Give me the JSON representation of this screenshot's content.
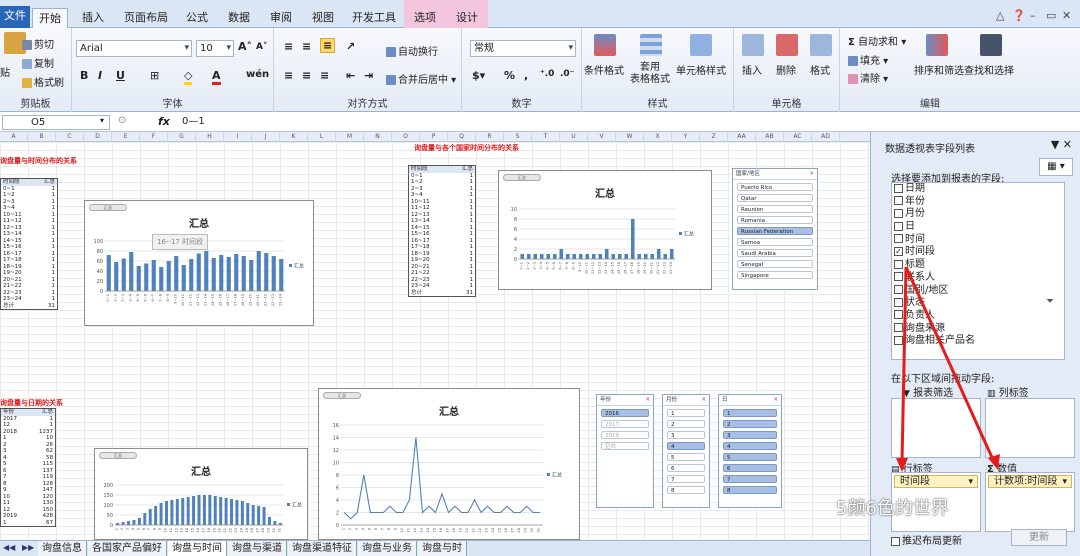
{
  "ribbon_tabs": [
    "文件",
    "开始",
    "插入",
    "页面布局",
    "公式",
    "数据",
    "审阅",
    "视图",
    "开发工具",
    "选项",
    "设计"
  ],
  "active_tab": "开始",
  "clipboard": {
    "paste": "贴",
    "cut": "剪切",
    "copy": "复制",
    "format_painter": "格式刷",
    "label": "剪贴板"
  },
  "font": {
    "name": "Arial",
    "size": "10",
    "bold": "B",
    "italic": "I",
    "underline": "U",
    "wen": "wén",
    "label": "字体"
  },
  "alignment": {
    "wrap": "自动换行",
    "merge": "合并后居中",
    "label": "对齐方式"
  },
  "number": {
    "format": "常规",
    "percent": "%",
    "comma": ",",
    "label": "数字"
  },
  "styles": {
    "conditional": "条件格式",
    "table_format": "套用\n表格格式",
    "cell_style": "单元格样式",
    "label": "样式"
  },
  "cells": {
    "insert": "插入",
    "delete": "删除",
    "format": "格式",
    "label": "单元格"
  },
  "editing": {
    "autosum": "自动求和",
    "fill": "填充",
    "clear": "清除",
    "sort_filter": "排序和筛选",
    "find_select": "查找和选择",
    "label": "编辑"
  },
  "formula_bar": {
    "name_box": "O5",
    "fx": "fx",
    "formula": "0—1"
  },
  "columns": [
    "A",
    "B",
    "C",
    "D",
    "E",
    "F",
    "G",
    "H",
    "I",
    "J",
    "K",
    "L",
    "M",
    "N",
    "O",
    "P",
    "Q",
    "R",
    "S",
    "T",
    "U",
    "V",
    "W",
    "X",
    "Y",
    "Z",
    "AA",
    "AB",
    "AC",
    "AD"
  ],
  "sheet": {
    "title1": "询盘量与时间分布的关系",
    "title2": "询盘量与各个国家时间分布的关系",
    "title3": "询盘量与日期的关系",
    "chart_title": "汇总",
    "tooltip": "16--17 时间段",
    "table1": {
      "header": [
        "时间段",
        "汇总"
      ],
      "rows": [
        [
          "0~1",
          "1"
        ],
        [
          "1~2",
          "1"
        ],
        [
          "2~3",
          "1"
        ],
        [
          "3~4",
          "1"
        ],
        [
          "10~11",
          "1"
        ],
        [
          "11~12",
          "1"
        ],
        [
          "12~13",
          "1"
        ],
        [
          "13~14",
          "1"
        ],
        [
          "14~15",
          "1"
        ],
        [
          "15~16",
          "1"
        ],
        [
          "16~17",
          "1"
        ],
        [
          "17~18",
          "1"
        ],
        [
          "18~19",
          "1"
        ],
        [
          "19~20",
          "1"
        ],
        [
          "20~21",
          "1"
        ],
        [
          "21~22",
          "1"
        ],
        [
          "22~23",
          "1"
        ],
        [
          "23~24",
          "1"
        ],
        [
          "总计",
          "31"
        ]
      ]
    },
    "table2": {
      "header": [
        "年份",
        "汇总"
      ],
      "rows": [
        [
          "2017",
          "1"
        ],
        [
          "12",
          "1"
        ],
        [
          "2018",
          "1237"
        ],
        [
          "1",
          "10"
        ],
        [
          "2",
          "26"
        ],
        [
          "3",
          "62"
        ],
        [
          "4",
          "58"
        ],
        [
          "5",
          "115"
        ],
        [
          "6",
          "137"
        ],
        [
          "7",
          "119"
        ],
        [
          "8",
          "128"
        ],
        [
          "9",
          "147"
        ],
        [
          "10",
          "120"
        ],
        [
          "11",
          "130"
        ],
        [
          "12",
          "150"
        ],
        [
          "2019",
          "428"
        ],
        [
          "1",
          "67"
        ]
      ]
    },
    "slicer_country": {
      "title": "国家/地区",
      "items": [
        "Puerto Rico",
        "Qatar",
        "Reunion",
        "Romania",
        "Russian Federation",
        "Samoa",
        "Saudi Arabia",
        "Senegal",
        "Singapore"
      ],
      "selected": "Russian Federation"
    },
    "slicer_year": {
      "title": "年份",
      "items": [
        "2016",
        "2017",
        "2019",
        "空白"
      ],
      "selected": "2016"
    },
    "slicer_month": {
      "title": "月份",
      "items": [
        "1",
        "2",
        "3",
        "4",
        "5",
        "6",
        "7",
        "8"
      ],
      "selected": "4"
    },
    "slicer_day": {
      "title": "日",
      "items": [
        "1",
        "2",
        "3",
        "4",
        "5",
        "6",
        "7",
        "8"
      ]
    }
  },
  "sheet_tabs": [
    "询盘信息",
    "各国家产品偏好",
    "询盘与时间",
    "询盘与渠道",
    "询盘渠道特征",
    "询盘与业务",
    "询盘与时"
  ],
  "active_sheet": "询盘与时间",
  "pane": {
    "title": "数据透视表字段列表",
    "prompt": "选择要添加到报表的字段:",
    "fields": [
      {
        "name": "日期",
        "checked": false
      },
      {
        "name": "年份",
        "checked": false
      },
      {
        "name": "月份",
        "checked": false
      },
      {
        "name": "日",
        "checked": false
      },
      {
        "name": "时间",
        "checked": false
      },
      {
        "name": "时间段",
        "checked": true
      },
      {
        "name": "标题",
        "checked": false
      },
      {
        "name": "联系人",
        "checked": false
      },
      {
        "name": "国别/地区",
        "checked": false
      },
      {
        "name": "状态",
        "checked": false
      },
      {
        "name": "负责人",
        "checked": false
      },
      {
        "name": "询盘来源",
        "checked": false
      },
      {
        "name": "询盘相关产品名",
        "checked": false
      }
    ],
    "area_prompt": "在以下区域间拖动字段:",
    "report_filter": "报表筛选",
    "column_labels": "列标签",
    "row_labels": "行标签",
    "values": "数值",
    "row_chip": "时间段",
    "value_chip": "计数项:时间段",
    "defer": "推迟布局更新",
    "update": "更新"
  },
  "watermark": "5颜6色的世界",
  "chart_data": [
    {
      "type": "bar",
      "title": "汇总",
      "categories": [
        "0~1",
        "1~2",
        "2~3",
        "3~4",
        "4~5",
        "5~6",
        "6~7",
        "7~8",
        "8~9",
        "9~10",
        "10~11",
        "11~12",
        "12~13",
        "13~14",
        "14~15",
        "15~16",
        "16~17",
        "17~18",
        "18~19",
        "19~20",
        "20~21",
        "21~22",
        "22~23",
        "23~24"
      ],
      "values": [
        72,
        58,
        65,
        78,
        50,
        55,
        62,
        48,
        60,
        70,
        52,
        64,
        75,
        80,
        66,
        72,
        68,
        74,
        70,
        62,
        80,
        76,
        70,
        64
      ],
      "legend": "汇总",
      "ylim": [
        0,
        100
      ]
    },
    {
      "type": "bar",
      "title": "汇总",
      "categories": [
        "0~1",
        "1~2",
        "2~3",
        "3~4",
        "4~5",
        "5~6",
        "6~7",
        "7~8",
        "8~9",
        "9~10",
        "10~11",
        "11~12",
        "12~13",
        "13~14",
        "14~15",
        "15~16",
        "16~17",
        "17~18",
        "18~19",
        "19~20",
        "20~21",
        "21~22",
        "22~23",
        "23~24"
      ],
      "values": [
        1,
        1,
        1,
        1,
        1,
        1,
        2,
        1,
        1,
        1,
        1,
        1,
        1,
        2,
        1,
        1,
        1,
        8,
        1,
        1,
        1,
        2,
        1,
        2
      ],
      "legend": "汇总",
      "ylim": [
        0,
        10
      ]
    },
    {
      "type": "bar",
      "title": "汇总",
      "categories": [
        "1",
        "2",
        "3",
        "4",
        "5",
        "6",
        "7",
        "8",
        "9",
        "10",
        "11",
        "12",
        "13",
        "14",
        "15",
        "16",
        "17",
        "18",
        "19",
        "20",
        "21",
        "22",
        "23",
        "24",
        "25",
        "26",
        "27",
        "28",
        "29",
        "30",
        "31"
      ],
      "values": [
        10,
        15,
        20,
        25,
        35,
        60,
        80,
        95,
        110,
        120,
        125,
        130,
        135,
        140,
        145,
        150,
        150,
        150,
        145,
        140,
        135,
        130,
        125,
        120,
        110,
        100,
        95,
        90,
        40,
        20,
        10
      ],
      "legend": "汇总",
      "ylim": [
        0,
        200
      ]
    },
    {
      "type": "line",
      "title": "汇总",
      "categories": [
        "1",
        "2",
        "3",
        "4",
        "5",
        "6",
        "7",
        "8",
        "9",
        "10",
        "11",
        "12",
        "13",
        "14",
        "15",
        "16",
        "17",
        "18",
        "19",
        "20",
        "21",
        "22",
        "23",
        "24",
        "25",
        "26",
        "27",
        "28",
        "29",
        "30",
        "31"
      ],
      "values": [
        2,
        1,
        2,
        8,
        2,
        2,
        2,
        3,
        2,
        2,
        4,
        14,
        2,
        3,
        2,
        5,
        2,
        3,
        2,
        2,
        4,
        2,
        3,
        2,
        2,
        3,
        2,
        2,
        3,
        2,
        2
      ],
      "legend": "汇总",
      "ylim": [
        0,
        16
      ]
    }
  ]
}
